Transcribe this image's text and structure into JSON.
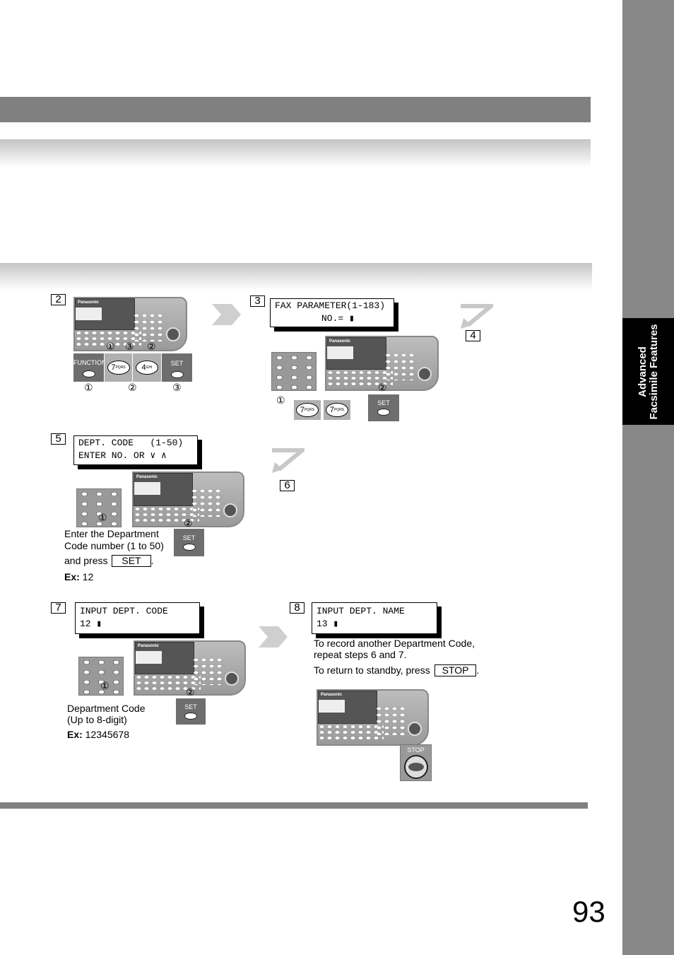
{
  "sidebar": {
    "tab_line1": "Advanced",
    "tab_line2": "Facsimile Features"
  },
  "page_number": "93",
  "steps": {
    "s2": {
      "label": "2",
      "function_label": "FUNCTION",
      "key1": "7",
      "key1_sub": "PQRS",
      "key2": "4",
      "key2_sub": "GHI",
      "set_label": "SET",
      "markers": [
        "①",
        "②",
        "③"
      ],
      "panel_markers": [
        "①",
        "③",
        "②"
      ]
    },
    "s3": {
      "label": "3",
      "lcd_line1": "FAX PARAMETER(1-183)",
      "lcd_line2": "NO.= ▮",
      "key1": "7",
      "key1_sub": "PQRS",
      "key2": "7",
      "key2_sub": "PQRS",
      "set_label": "SET",
      "markers": [
        "①",
        "②"
      ]
    },
    "s4": {
      "label": "4"
    },
    "s5": {
      "label": "5",
      "lcd_line1": "DEPT. CODE   (1-50)",
      "lcd_line2": "ENTER NO. OR ∨ ∧",
      "set_label": "SET",
      "markers": [
        "①",
        "②"
      ],
      "text1": "Enter the Department",
      "text2": "Code number (1 to 50)",
      "text3": "and press",
      "text3_key": "SET",
      "text3_end": ".",
      "ex_label": "Ex:",
      "ex_value": " 12"
    },
    "s6": {
      "label": "6"
    },
    "s7": {
      "label": "7",
      "lcd_line1": "INPUT DEPT. CODE",
      "lcd_line2": "12 ▮",
      "set_label": "SET",
      "markers": [
        "①",
        "②"
      ],
      "text1": "Department Code",
      "text2": "(Up to 8-digit)",
      "ex_label": "Ex:",
      "ex_value": " 12345678"
    },
    "s8": {
      "label": "8",
      "lcd_line1": "INPUT DEPT. NAME",
      "lcd_line2": "13 ▮",
      "text1": "To record another Department Code,",
      "text2": "repeat steps 6 and 7.",
      "text3": "To return to standby, press",
      "text3_key": "STOP",
      "text3_end": ".",
      "stop_label": "STOP"
    }
  },
  "panel_brand": "Panasonic"
}
